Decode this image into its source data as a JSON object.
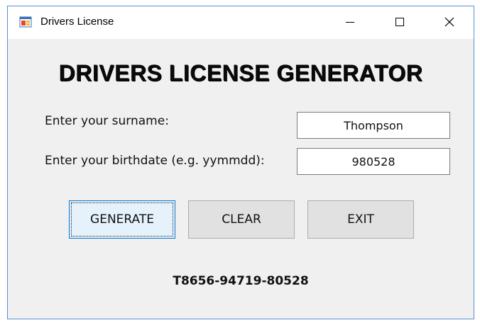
{
  "window": {
    "title": "Drivers License",
    "app_icon": "winforms-app-icon",
    "controls": {
      "minimize": "minimize-icon",
      "maximize": "maximize-icon",
      "close": "close-icon"
    },
    "border_color": "#5a8ed6",
    "background": "#f0f0f0"
  },
  "heading": "DRIVERS LICENSE GENERATOR",
  "form": {
    "surname_label": "Enter your surname:",
    "surname_value": "Thompson",
    "birthdate_label": "Enter your birthdate (e.g. yymmdd):",
    "birthdate_value": "980528"
  },
  "buttons": {
    "generate": "GENERATE",
    "clear": "CLEAR",
    "exit": "EXIT"
  },
  "result": "T8656-94719-80528"
}
